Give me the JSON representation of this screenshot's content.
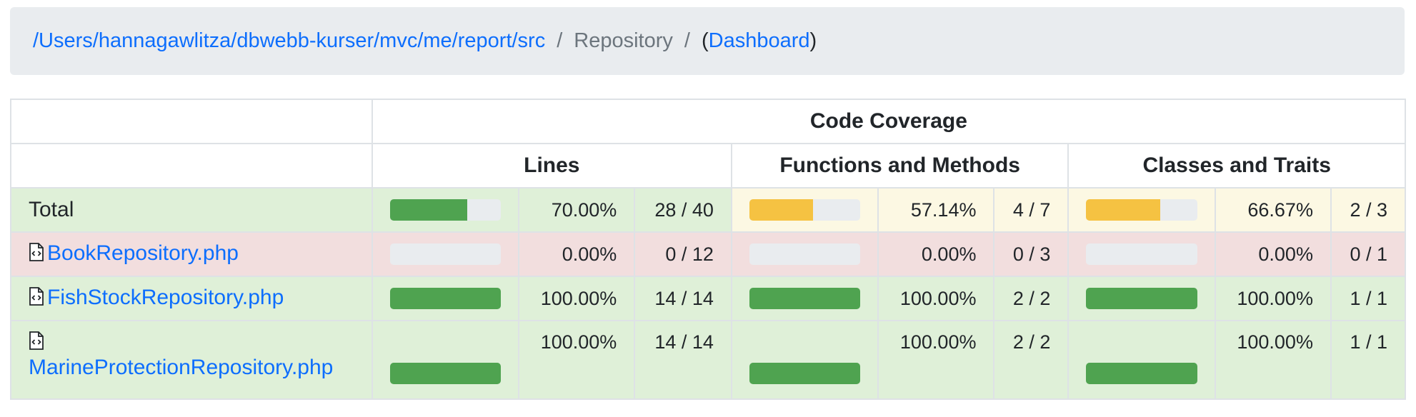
{
  "breadcrumb": {
    "path": "/Users/hannagawlitza/dbwebb-kurser/mvc/me/report/src",
    "sep1": "/",
    "current": "Repository",
    "sep2": "/",
    "open_paren": "(",
    "dashboard": "Dashboard",
    "close_paren": ")"
  },
  "table": {
    "title": "Code Coverage",
    "groups": {
      "lines": "Lines",
      "functions": "Functions and Methods",
      "classes": "Classes and Traits"
    },
    "rows": [
      {
        "name": "Total",
        "lines": {
          "pct": "70.00%",
          "ratio": "28 / 40",
          "fill": 0.7
        },
        "functions": {
          "pct": "57.14%",
          "ratio": "4 / 7",
          "fill": 0.5714
        },
        "classes": {
          "pct": "66.67%",
          "ratio": "2 / 3",
          "fill": 0.6667
        }
      },
      {
        "name": "BookRepository.php",
        "icon": "code-file-icon",
        "lines": {
          "pct": "0.00%",
          "ratio": "0 / 12",
          "fill": 0
        },
        "functions": {
          "pct": "0.00%",
          "ratio": "0 / 3",
          "fill": 0
        },
        "classes": {
          "pct": "0.00%",
          "ratio": "0 / 1",
          "fill": 0
        }
      },
      {
        "name": "FishStockRepository.php",
        "icon": "code-file-icon",
        "lines": {
          "pct": "100.00%",
          "ratio": "14 / 14",
          "fill": 1
        },
        "functions": {
          "pct": "100.00%",
          "ratio": "2 / 2",
          "fill": 1
        },
        "classes": {
          "pct": "100.00%",
          "ratio": "1 / 1",
          "fill": 1
        }
      },
      {
        "name": "MarineProtectionRepository.php",
        "icon": "code-file-icon",
        "lines": {
          "pct": "100.00%",
          "ratio": "14 / 14",
          "fill": 1
        },
        "functions": {
          "pct": "100.00%",
          "ratio": "2 / 2",
          "fill": 1
        },
        "classes": {
          "pct": "100.00%",
          "ratio": "1 / 1",
          "fill": 1
        }
      }
    ]
  },
  "colors": {
    "high_bg": "#dff0d8",
    "medium_bg": "#fcf8e3",
    "low_bg": "#f2dede",
    "high_bar": "#4fa350",
    "medium_bar": "#f5c242",
    "link": "#0d6efd"
  }
}
